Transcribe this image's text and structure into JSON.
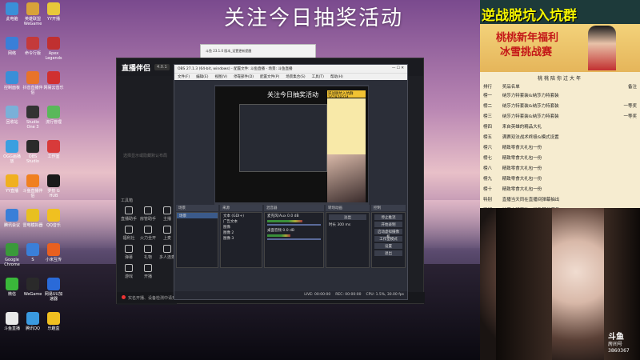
{
  "banner": "关注今日抽奖活动",
  "desktop_icons": [
    {
      "label": "此电脑",
      "color": "#3a8fd8"
    },
    {
      "label": "英雄联盟WeGame",
      "color": "#d8a23a"
    },
    {
      "label": "YY开播",
      "color": "#e8c83a"
    },
    {
      "label": "网络",
      "color": "#3a7fd8"
    },
    {
      "label": "命令行版",
      "color": "#c43a3a"
    },
    {
      "label": "Apex Legends",
      "color": "#c03030"
    },
    {
      "label": "控制面板",
      "color": "#3a8fd8"
    },
    {
      "label": "抖音直播伴侣",
      "color": "#e8732a"
    },
    {
      "label": "网易云音乐",
      "color": "#d03030"
    },
    {
      "label": "回收站",
      "color": "#7ab0d8"
    },
    {
      "label": "Studio One 3",
      "color": "#333333"
    },
    {
      "label": "流行管理",
      "color": "#5ab85a"
    },
    {
      "label": "OGG画播放",
      "color": "#3a9fe0"
    },
    {
      "label": "OBS Studio",
      "color": "#2a2a2a"
    },
    {
      "label": "工作室",
      "color": "#d83a3a"
    },
    {
      "label": "YY直播",
      "color": "#f0b020"
    },
    {
      "label": "斗鱼直播伴侣",
      "color": "#f08020"
    },
    {
      "label": "罗技 G HUB",
      "color": "#1a1a1a"
    },
    {
      "label": "腾讯会议",
      "color": "#3a7fd8"
    },
    {
      "label": "雷电模拟器",
      "color": "#e8c020"
    },
    {
      "label": "QQ音乐",
      "color": "#f0c020"
    },
    {
      "label": "Google Chrome",
      "color": "#3a9a3a"
    },
    {
      "label": "S",
      "color": "#3a7fd8"
    },
    {
      "label": "小米互传",
      "color": "#e86020"
    },
    {
      "label": "微信",
      "color": "#3ab83a"
    },
    {
      "label": "WeGame",
      "color": "#2a2a2a"
    },
    {
      "label": "网易UU加速器",
      "color": "#2a6ad8"
    },
    {
      "label": "斗鱼直播",
      "color": "#e8e8e8"
    },
    {
      "label": "腾讯QQ",
      "color": "#3a9ae0"
    },
    {
      "label": "乐趣盒",
      "color": "#f0c020"
    }
  ],
  "zhibobanlv": {
    "logo": "直播伴侣",
    "badge": "4.0.1",
    "hint": "选择显示或隐藏默认布局",
    "tools_title": "工具箱",
    "tools": [
      "直播助手",
      "房管助手",
      "主播",
      "福利社",
      "火力全开",
      "上麦",
      "弹幕",
      "礼物",
      "多人连麦",
      "游戏",
      "开播"
    ],
    "status": "实名开播、设备检测中请开始检测中，请稍等"
  },
  "smallwin": {
    "title": "斗鱼 23.1.0 版本_设置更新提醒"
  },
  "obs": {
    "title": "OBS 27.1.3 (64-bit, windows) - 配置文件: 斗鱼直播 - 场景: 斗鱼直播",
    "menu": [
      "文件(F)",
      "编辑(E)",
      "视图(V)",
      "停靠部件(D)",
      "配置文件(P)",
      "场景集合(S)",
      "工具(T)",
      "帮助(H)"
    ],
    "preview_banner": "关注今日抽奖活动",
    "preview_tag": "逆战脱坑入坑群167978374",
    "dock_titles": {
      "scenes": "场景",
      "sources": "来源",
      "mixer": "混音器",
      "transitions": "转场动画",
      "controls": "控制"
    },
    "scenes": [
      "场景"
    ],
    "sources": [
      "文本 (GDI+)",
      "广告文本",
      "图像",
      "图像 2",
      "图像 3"
    ],
    "mixer": [
      {
        "name": "麦克风/Aux",
        "db": "0.0 dB",
        "level": 0.6
      },
      {
        "name": "桌面音频",
        "db": "0.0 dB",
        "level": 0.4
      }
    ],
    "transition": {
      "type": "淡出",
      "duration_label": "时长",
      "duration": "300 ms"
    },
    "controls": [
      "停止推流",
      "开始录制",
      "启动虚拟摄像机",
      "工作室模式",
      "设置",
      "退出"
    ],
    "status": [
      "LIVE: 00:00:00",
      "REC: 00:00:00",
      "CPU: 1.5%, 30.00 fps"
    ]
  },
  "right_panel": {
    "title": "逆战脱坑入坑群167978374",
    "poster_line1": "桃桃新年福利",
    "poster_line2": "冰雪挑战赛",
    "prize_header": "桃桃陪你过大年",
    "columns": [
      "排行",
      "奖品名单",
      "备注"
    ],
    "prizes": [
      {
        "rank": "榜一",
        "prize": "纳莎力特套装&纳莎力特套装",
        "note": ""
      },
      {
        "rank": "榜二",
        "prize": "纳莎力特套装&纳莎力特套装",
        "note": "一等奖"
      },
      {
        "rank": "榜三",
        "prize": "纳莎力特套装&纳莎力特套装",
        "note": "一等奖"
      },
      {
        "rank": "榜四",
        "prize": "来自英雄的精品大礼",
        "note": ""
      },
      {
        "rank": "榜五",
        "prize": "满赛双法战术终极&模式设置",
        "note": ""
      },
      {
        "rank": "榜六",
        "prize": "精致零食大礼包一份",
        "note": ""
      },
      {
        "rank": "榜七",
        "prize": "精致零食大礼包一份",
        "note": ""
      },
      {
        "rank": "榜八",
        "prize": "精致零食大礼包一份",
        "note": ""
      },
      {
        "rank": "榜九",
        "prize": "精致零食大礼包一份",
        "note": ""
      },
      {
        "rank": "榜十",
        "prize": "精致零食大礼包一份",
        "note": ""
      },
      {
        "rank": "特别",
        "prize": "直播当天同在直播间弹幕抽出",
        "note": ""
      },
      {
        "rank": "江湖",
        "prize": "纳莎力特套装一份及其他道具",
        "note": ""
      }
    ]
  },
  "watermark": {
    "brand": "斗鱼",
    "sub": "房间号",
    "room": "3860367"
  }
}
